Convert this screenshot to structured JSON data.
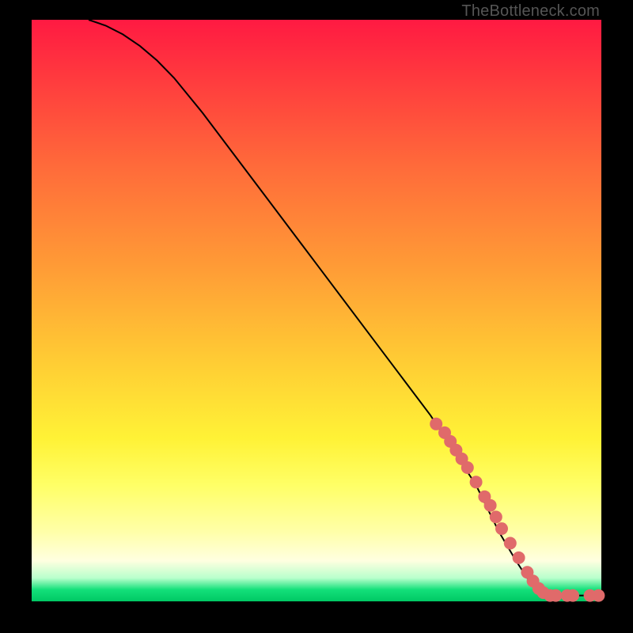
{
  "watermark": "TheBottleneck.com",
  "chart_data": {
    "type": "line",
    "title": "",
    "xlabel": "",
    "ylabel": "",
    "xlim": [
      0,
      100
    ],
    "ylim": [
      0,
      100
    ],
    "line": {
      "name": "curve",
      "x": [
        10,
        13,
        16,
        19,
        22,
        25,
        30,
        40,
        50,
        60,
        70,
        78,
        82,
        85,
        87,
        88,
        90,
        92,
        95,
        100
      ],
      "y": [
        100,
        99,
        97.5,
        95.5,
        93,
        90,
        84,
        71,
        58,
        45,
        32,
        20,
        12,
        7,
        4,
        2.5,
        1.5,
        1,
        1,
        1
      ]
    },
    "markers": {
      "name": "points",
      "color": "#e06a6a",
      "radius": 8,
      "x": [
        71,
        72.5,
        73.5,
        74.5,
        75.5,
        76.5,
        78,
        79.5,
        80.5,
        81.5,
        82.5,
        84,
        85.5,
        87,
        88,
        89,
        89.8,
        91,
        92,
        94,
        95,
        98,
        99.5
      ],
      "y": [
        30.5,
        29,
        27.5,
        26,
        24.5,
        23,
        20.5,
        18,
        16.5,
        14.5,
        12.5,
        10,
        7.5,
        5,
        3.5,
        2.2,
        1.5,
        1,
        1,
        1,
        1,
        1,
        1
      ]
    }
  }
}
